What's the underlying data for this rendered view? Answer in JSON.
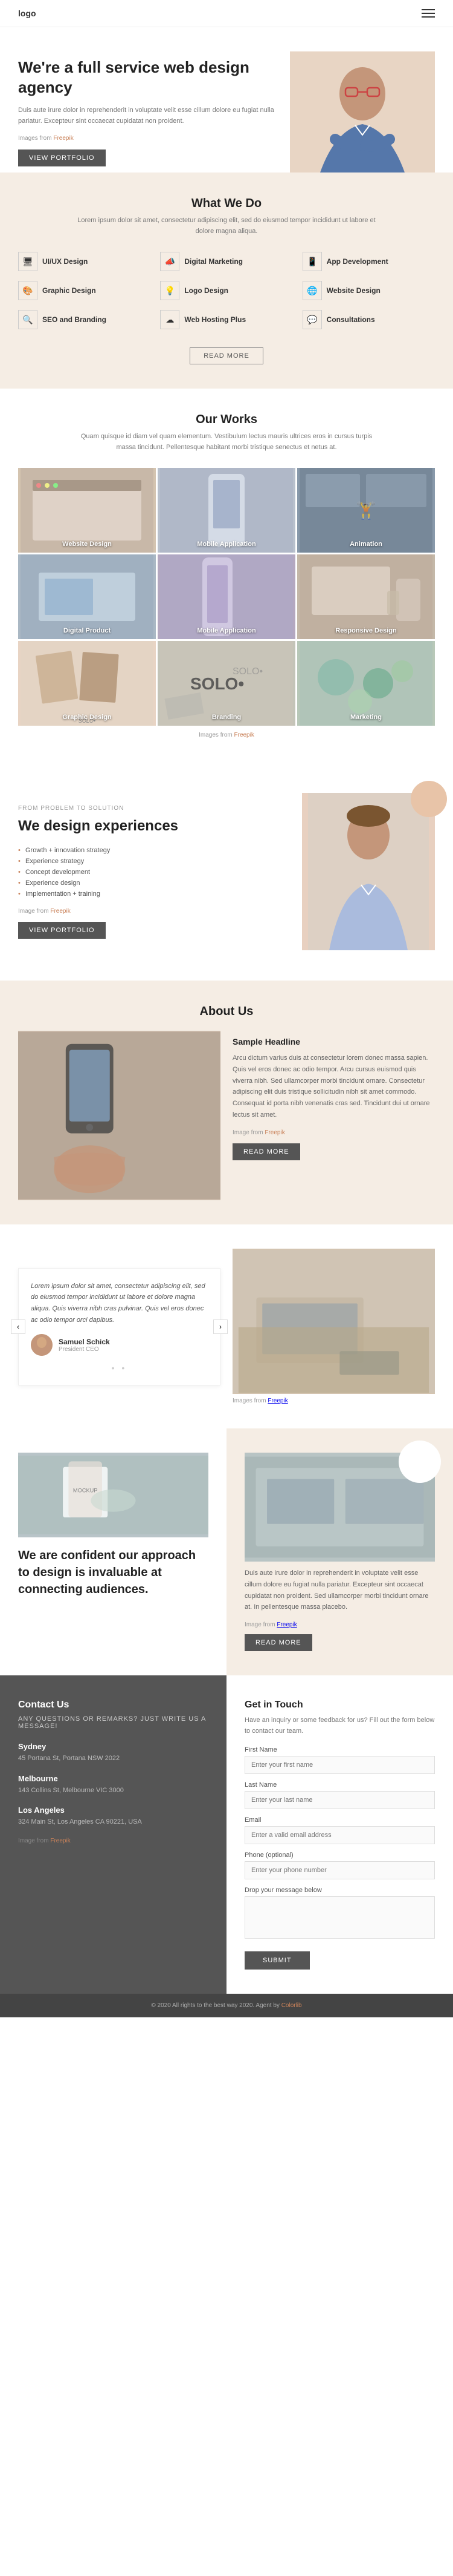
{
  "nav": {
    "logo": "logo",
    "hamburger_label": "menu"
  },
  "hero": {
    "title": "We're a full service web design agency",
    "body": "Duis aute irure dolor in reprehenderit in voluptate velit esse cillum dolore eu fugiat nulla pariatur. Excepteur sint occaecat cupidatat non proident.",
    "img_credit_prefix": "Images from",
    "img_credit_link": "Freepik",
    "btn_portfolio": "VIEW PORTFOLIO"
  },
  "what_we_do": {
    "title": "What We Do",
    "subtitle": "Lorem ipsum dolor sit amet, consectetur adipiscing elit, sed do eiusmod tempor incididunt ut labore et dolore magna aliqua.",
    "services": [
      {
        "icon": "🖥",
        "label": "UI/UX Design"
      },
      {
        "icon": "📣",
        "label": "Digital Marketing"
      },
      {
        "icon": "📱",
        "label": "App Development"
      },
      {
        "icon": "🎨",
        "label": "Graphic Design"
      },
      {
        "icon": "💡",
        "label": "Logo Design"
      },
      {
        "icon": "🌐",
        "label": "Website Design"
      },
      {
        "icon": "🔍",
        "label": "SEO and Branding"
      },
      {
        "icon": "☁",
        "label": "Web Hosting Plus"
      },
      {
        "icon": "💬",
        "label": "Consultations"
      }
    ],
    "btn_read_more": "READ MORE"
  },
  "our_works": {
    "title": "Our Works",
    "subtitle": "Quam quisque id diam vel quam elementum. Vestibulum lectus mauris ultrices eros in cursus turpis massa tincidunt. Pellentesque habitant morbi tristique senectus et netus at.",
    "items": [
      {
        "label": "Website Design",
        "color": "work-c1"
      },
      {
        "label": "Mobile Application",
        "color": "work-c2"
      },
      {
        "label": "Animation",
        "color": "work-c3"
      },
      {
        "label": "Digital Product",
        "color": "work-c4"
      },
      {
        "label": "Mobile Application",
        "color": "work-c5"
      },
      {
        "label": "Responsive Design",
        "color": "work-c6"
      },
      {
        "label": "Graphic Design",
        "color": "work-c7"
      },
      {
        "label": "Branding",
        "color": "work-c8"
      },
      {
        "label": "Marketing",
        "color": "work-c9"
      }
    ],
    "img_credit_prefix": "Images from",
    "img_credit_link": "Freepik"
  },
  "problem_solution": {
    "label": "FROM PROBLEM TO SOLUTION",
    "title": "We design experiences",
    "list": [
      "Growth + innovation strategy",
      "Experience strategy",
      "Concept development",
      "Experience design",
      "Implementation + training"
    ],
    "img_credit_prefix": "Image from",
    "img_credit_link": "Freepik",
    "btn_portfolio": "VIEW PORTFOLIO"
  },
  "about_us": {
    "title": "About Us",
    "headline": "Sample Headline",
    "body": "Arcu dictum varius duis at consectetur lorem donec massa sapien. Quis vel eros donec ac odio tempor. Arcu cursus euismod quis viverra nibh. Sed ullamcorper morbi tincidunt ornare. Consectetur adipiscing elit duis tristique sollicitudin nibh sit amet commodo. Consequat id porta nibh venenatis cras sed. Tincidunt dui ut ornare lectus sit amet.",
    "img_credit_prefix": "Image from",
    "img_credit_link": "Freepik",
    "btn_read_more": "READ MORE"
  },
  "testimonial": {
    "quote": "Lorem ipsum dolor sit amet, consectetur adipiscing elit, sed do eiusmod tempor incididunt ut labore et dolore magna aliqua. Quis viverra nibh cras pulvinar. Quis vel eros donec ac odio tempor orci dapibus.",
    "author_name": "Samuel Schick",
    "author_title": "President CEO",
    "img_credit_prefix": "Images from",
    "img_credit_link": "Freepik",
    "prev_arrow": "‹",
    "next_arrow": "›",
    "dots": "• •"
  },
  "confidence": {
    "title": "We are confident our approach to design is invaluable at connecting audiences.",
    "body": "Duis aute irure dolor in reprehenderit in voluptate velit esse cillum dolore eu fugiat nulla pariatur. Excepteur sint occaecat cupidatat non proident. Sed ullamcorper morbi tincidunt ornare at. In pellentesque massa placebo.",
    "img_credit_prefix": "Image from",
    "img_credit_link": "Freepik",
    "btn_read_more": "READ MORE"
  },
  "contact": {
    "left": {
      "title": "Contact Us",
      "tagline": "ANY QUESTIONS OR REMARKS? JUST WRITE US A MESSAGE!",
      "offices": [
        {
          "city": "Sydney",
          "address": "45 Portana St, Portana NSW 2022"
        },
        {
          "city": "Melbourne",
          "address": "143 Collins St, Melbourne VIC 3000"
        },
        {
          "city": "Los Angeles",
          "address": "324 Main St, Los Angeles CA 90221, USA"
        }
      ],
      "img_credit_prefix": "Image from",
      "img_credit_link": "Freepik"
    },
    "right": {
      "title": "Get in Touch",
      "intro": "Have an inquiry or some feedback for us? Fill out the form below to contact our team.",
      "fields": [
        {
          "label": "First Name",
          "placeholder": "Enter your first name"
        },
        {
          "label": "Last Name",
          "placeholder": "Enter your last name"
        },
        {
          "label": "Email",
          "placeholder": "Enter a valid email address"
        },
        {
          "label": "Phone (optional)",
          "placeholder": "Enter your phone number"
        },
        {
          "label": "Drop your message below",
          "placeholder": "",
          "type": "textarea"
        }
      ],
      "btn_submit": "SUBMIT"
    }
  },
  "footer": {
    "text": "© 2020 All rights to the best way 2020. Agent by",
    "link": "Colorlib"
  }
}
